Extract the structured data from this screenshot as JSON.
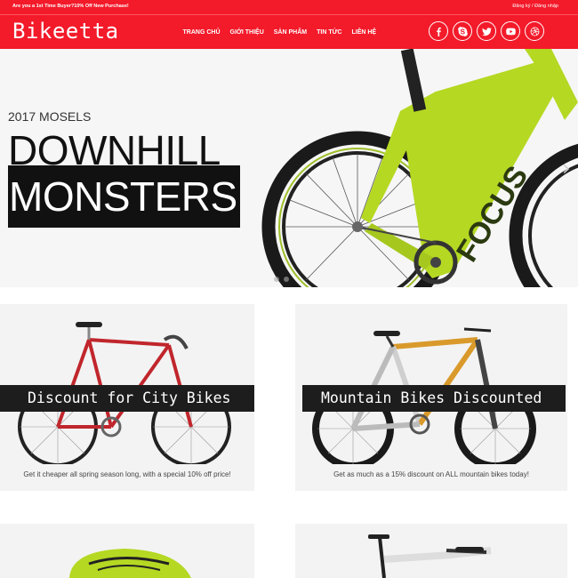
{
  "topbar": {
    "promo": "Are you a 1st Time Buyer?10% Off New Purchase!",
    "auth": "Đăng ký / Đăng nhập"
  },
  "header": {
    "logo": "Bikeetta",
    "nav": [
      "TRANG CHỦ",
      "GIỚI THIỆU",
      "SẢN PHẨM",
      "TIN TỨC",
      "LIÊN HỆ"
    ],
    "social_icons": [
      "facebook-icon",
      "skype-icon",
      "twitter-icon",
      "youtube-icon",
      "dribbble-icon"
    ]
  },
  "hero": {
    "eyebrow": "2017 MOSELS",
    "line1": "DOWNHILL",
    "line2": "MONSTERS"
  },
  "promos": [
    {
      "title": "Discount for City Bikes",
      "caption": "Get it cheaper all spring season long, with a special 10% off price!"
    },
    {
      "title": "Mountain Bikes Discounted",
      "caption": "Get as much as a 15% discount on ALL mountain bikes today!"
    }
  ],
  "colors": {
    "brand_red": "#f31a2a",
    "bike_green": "#b5d823",
    "banner_black": "#1d1d1d"
  }
}
